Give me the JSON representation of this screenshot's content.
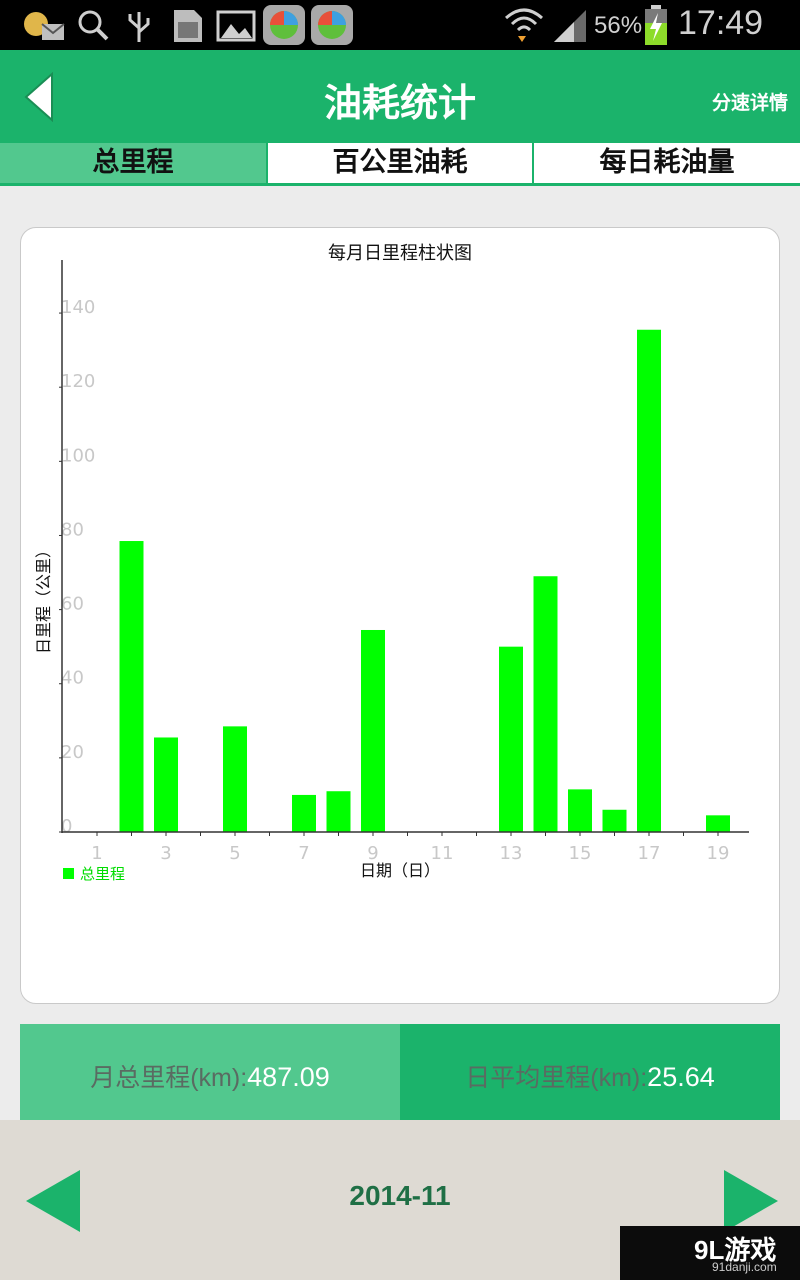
{
  "status_bar": {
    "battery": "56%",
    "time": "17:49",
    "icons": [
      "app-notification-icon",
      "search-icon",
      "usb-icon",
      "sd-card-icon",
      "gallery-icon",
      "app-store-icon",
      "app-store-icon",
      "wifi-icon",
      "signal-icon",
      "battery-charging-icon"
    ]
  },
  "header": {
    "title": "油耗统计",
    "right_action": "分速详情",
    "back_icon": "back-arrow-icon"
  },
  "tabs": [
    {
      "label": "总里程",
      "active": true
    },
    {
      "label": "百公里油耗",
      "active": false
    },
    {
      "label": "每日耗油量",
      "active": false
    }
  ],
  "chart_data": {
    "type": "bar",
    "title": "每月日里程柱状图",
    "xlabel": "日期（日）",
    "ylabel": "日里程（公里）",
    "x": [
      1,
      2,
      3,
      4,
      5,
      6,
      7,
      8,
      9,
      10,
      11,
      12,
      13,
      14,
      15,
      16,
      17,
      18,
      19
    ],
    "x_tick_labels": [
      "1",
      "3",
      "5",
      "7",
      "9",
      "11",
      "13",
      "15",
      "17",
      "19"
    ],
    "y_ticks": [
      "0",
      "20",
      "40",
      "60",
      "80",
      "100",
      "120",
      "140"
    ],
    "ylim": [
      0,
      150
    ],
    "series": [
      {
        "name": "总里程",
        "color": "#00ff00",
        "values": [
          0,
          78.5,
          25.5,
          0,
          28.5,
          0,
          10,
          11,
          54.5,
          0,
          0,
          0,
          50,
          69,
          11.5,
          6,
          135.5,
          0,
          4.5
        ]
      }
    ],
    "legend_position": "bottom-left",
    "grid": false
  },
  "summary": {
    "total_label": "月总里程(km):",
    "total_value": "487.09",
    "avg_label": "日平均里程(km):",
    "avg_value": "25.64"
  },
  "footer": {
    "month": "2014-11",
    "prev_icon": "prev-arrow-icon",
    "next_icon": "next-arrow-icon"
  },
  "watermark": {
    "brand": "9L游戏",
    "site": "91danji.com"
  },
  "colors": {
    "primary": "#1bb36b",
    "light": "#52c88e",
    "bar": "#00ff00",
    "month_text": "#1f6f45"
  }
}
